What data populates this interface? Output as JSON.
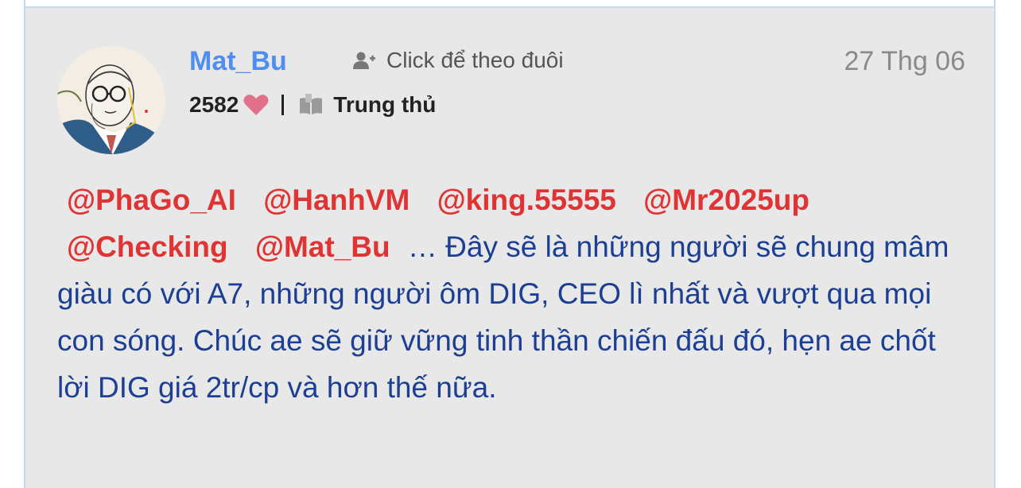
{
  "post": {
    "username": "Mat_Bu",
    "follow_label": "Click để theo đuôi",
    "date": "27 Thg 06",
    "likes": "2582",
    "rank": "Trung thủ",
    "mentions": [
      "@PhaGo_AI",
      "@HanhVM",
      "@king.55555",
      "@Mr2025up",
      "@Checking",
      "@Mat_Bu"
    ],
    "body_text": "… Đây sẽ là những người sẽ chung mâm giàu có với A7, những người ôm DIG, CEO lì nhất và vượt qua mọi con sóng. Chúc ae sẽ giữ vững tinh thần chiến đấu đó, hẹn ae chốt lời DIG giá 2tr/cp và hơn thế nữa."
  },
  "icons": {
    "follow": "add-user-icon",
    "likes": "heart-icon",
    "rank": "book-icon"
  },
  "colors": {
    "username": "#4d8ef0",
    "mention": "#e03434",
    "body": "#1c3f94",
    "heart": "#e2708a"
  }
}
